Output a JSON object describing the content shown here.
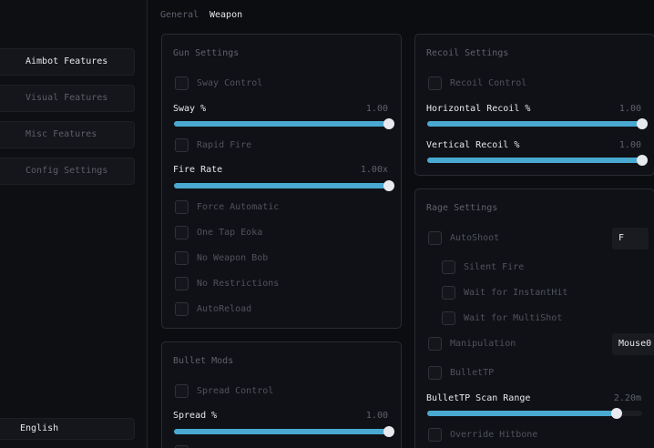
{
  "sidebar": {
    "items": [
      {
        "label": "Aimbot Features"
      },
      {
        "label": "Visual Features"
      },
      {
        "label": "Misc Features"
      },
      {
        "label": "Config Settings"
      }
    ],
    "language": "English"
  },
  "tabs": [
    {
      "label": "General"
    },
    {
      "label": "Weapon"
    }
  ],
  "gun_settings": {
    "title": "Gun Settings",
    "sway_control": "Sway Control",
    "sway": {
      "label": "Sway %",
      "value": "1.00",
      "fraction": 1.0
    },
    "rapid_fire": "Rapid Fire",
    "fire_rate": {
      "label": "Fire Rate",
      "value": "1.00x",
      "fraction": 1.0
    },
    "force_automatic": "Force Automatic",
    "one_tap_eoka": "One Tap Eoka",
    "no_weapon_bob": "No Weapon Bob",
    "no_restrictions": "No Restrictions",
    "auto_reload": "AutoReload"
  },
  "bullet_mods": {
    "title": "Bullet Mods",
    "spread_control": "Spread Control",
    "spread": {
      "label": "Spread %",
      "value": "1.00",
      "fraction": 1.0
    }
  },
  "recoil_settings": {
    "title": "Recoil Settings",
    "recoil_control": "Recoil Control",
    "horizontal": {
      "label": "Horizontal Recoil %",
      "value": "1.00",
      "fraction": 1.0
    },
    "vertical": {
      "label": "Vertical Recoil %",
      "value": "1.00",
      "fraction": 1.0
    }
  },
  "rage_settings": {
    "title": "Rage Settings",
    "autoshoot": "AutoShoot",
    "autoshoot_key": "F",
    "silent_fire": "Silent Fire",
    "wait_instanthit": "Wait for InstantHit",
    "wait_multishot": "Wait for MultiShot",
    "manipulation": "Manipulation",
    "manipulation_key": "Mouse0",
    "bullettp": "BulletTP",
    "bullettp_range": {
      "label": "BulletTP Scan Range",
      "value": "2.20m",
      "fraction": 0.88
    },
    "override_hitbone": "Override Hitbone"
  },
  "colors": {
    "accent": "#49a9d1",
    "knob": "#e8e9ee",
    "panel_bg": "#101116",
    "page_bg": "#0c0d11"
  }
}
